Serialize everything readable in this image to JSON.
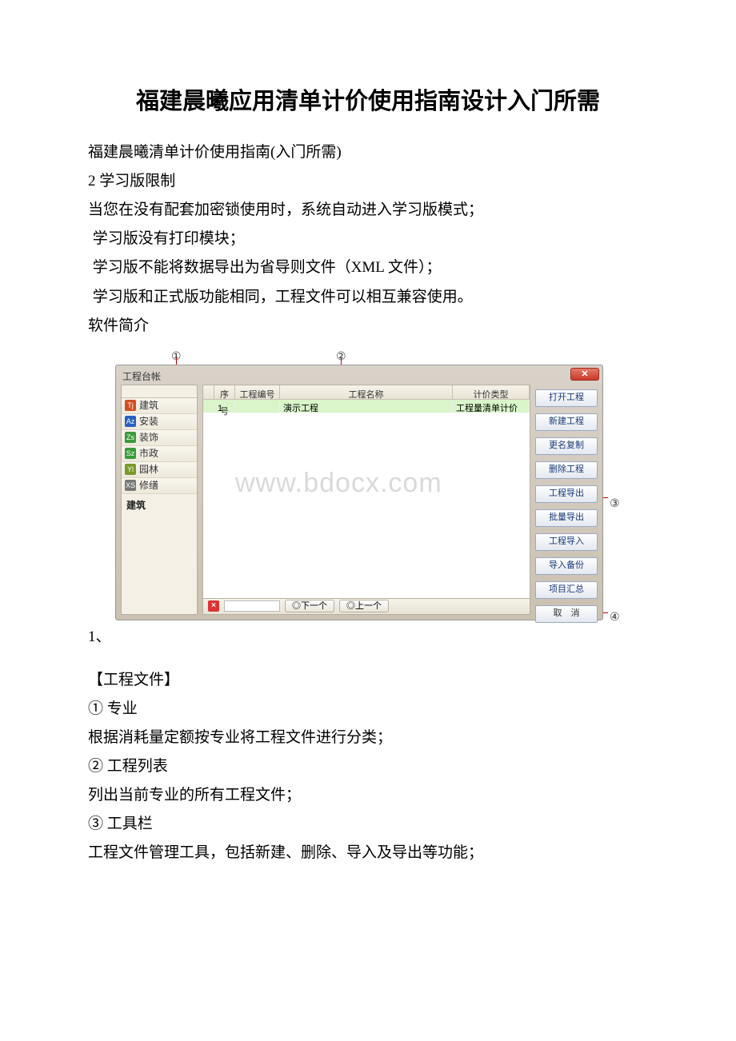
{
  "title": "福建晨曦应用清单计价使用指南设计入门所需",
  "intro": [
    "福建晨曦清单计价使用指南(入门所需)",
    "2 学习版限制",
    "当您在没有配套加密锁使用时，系统自动进入学习版模式；",
    "  学习版没有打印模块；",
    "  学习版不能将数据导出为省导则文件（XML 文件）；",
    "  学习版和正式版功能相同，工程文件可以相互兼容使用。",
    "软件简介"
  ],
  "screenshot": {
    "window_title": "工程台帐",
    "close_label": "✕",
    "sidebar": {
      "items": [
        {
          "icon": "Tj",
          "color": "#d05020",
          "label": "建筑"
        },
        {
          "icon": "Az",
          "color": "#2a5fbf",
          "label": "安装"
        },
        {
          "icon": "Zs",
          "color": "#3a9a3a",
          "label": "装饰"
        },
        {
          "icon": "Sz",
          "color": "#3a9a3a",
          "label": "市政"
        },
        {
          "icon": "Yl",
          "color": "#7a9a2a",
          "label": "园林"
        },
        {
          "icon": "XS",
          "color": "#777",
          "label": "修缮"
        }
      ],
      "selected": "建筑"
    },
    "grid": {
      "headers": {
        "idx": "",
        "seq": "序号",
        "code": "工程编号",
        "name": "工程名称",
        "type": "计价类型"
      },
      "row": {
        "seq": "1",
        "code": "",
        "name": "演示工程",
        "type": "工程量清单计价"
      }
    },
    "footer": {
      "next": "◎下一个",
      "prev": "◎上一个"
    },
    "buttons": [
      "打开工程",
      "新建工程",
      "更名复制",
      "删除工程",
      "工程导出",
      "批量导出",
      "工程导入",
      "导入备份",
      "项目汇总",
      "取　消"
    ],
    "watermark": "www.bdocx.com",
    "anno": {
      "c1": "①",
      "c2": "②",
      "c3": "③",
      "c4": "④"
    }
  },
  "caption_prefix": "1、",
  "body": [
    "【工程文件】",
    "① 专业",
    "根据消耗量定额按专业将工程文件进行分类；",
    "② 工程列表",
    "列出当前专业的所有工程文件；",
    "③ 工具栏",
    "工程文件管理工具，包括新建、删除、导入及导出等功能；"
  ]
}
